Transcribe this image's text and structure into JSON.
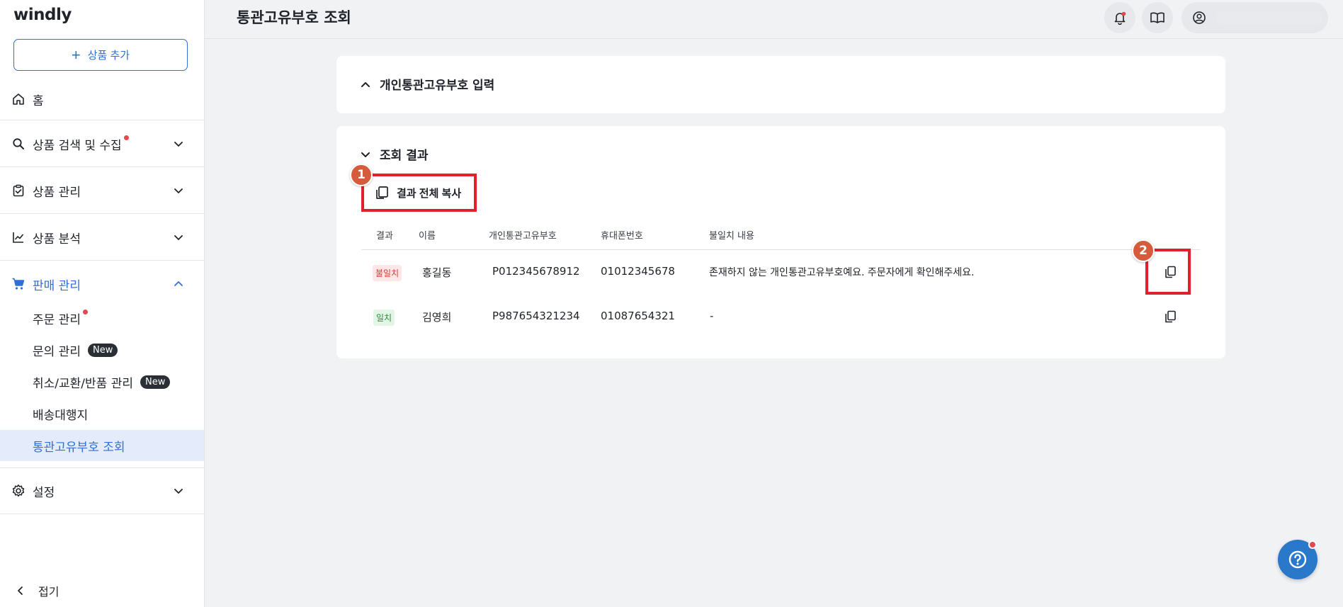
{
  "brand": {
    "logo": "windly"
  },
  "sidebar": {
    "add_button": "상품 추가",
    "items": [
      {
        "label": "홈"
      },
      {
        "label": "상품 검색 및 수집"
      },
      {
        "label": "상품 관리"
      },
      {
        "label": "상품 분석"
      },
      {
        "label": "판매 관리"
      },
      {
        "label": "설정"
      }
    ],
    "sub_items": [
      {
        "label": "주문 관리"
      },
      {
        "label": "문의 관리",
        "badge": "New"
      },
      {
        "label": "취소/교환/반품 관리",
        "badge": "New"
      },
      {
        "label": "배송대행지"
      },
      {
        "label": "통관고유부호 조회"
      }
    ],
    "collapse_label": "접기"
  },
  "header": {
    "title": "통관고유부호 조회"
  },
  "input_section": {
    "title": "개인통관고유부호 입력"
  },
  "results": {
    "title": "조회 결과",
    "copy_all_label": "결과 전체 복사",
    "columns": [
      "결과",
      "이름",
      "개인통관고유부호",
      "휴대폰번호",
      "불일치 내용"
    ],
    "rows": [
      {
        "status": "불일치",
        "name": "홍길동",
        "code": "P012345678912",
        "phone": "01012345678",
        "detail": "존재하지 않는 개인통관고유부호예요. 주문자에게 확인해주세요."
      },
      {
        "status": "일치",
        "name": "김영희",
        "code": "P987654321234",
        "phone": "01087654321",
        "detail": "-"
      }
    ]
  },
  "markers": [
    "1",
    "2"
  ],
  "colors": {
    "accent": "#2f6fd6",
    "highlight": "#e0212a",
    "marker": "#d65a3c",
    "mismatch": "#d23c3c",
    "match": "#2a8a3a"
  }
}
